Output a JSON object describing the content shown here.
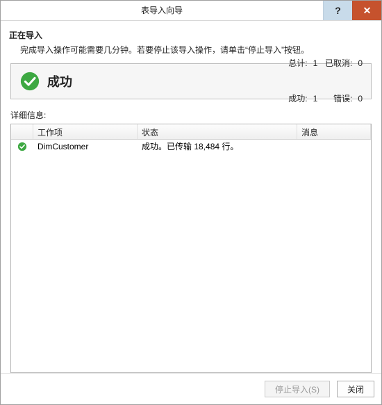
{
  "window": {
    "title": "表导入向导"
  },
  "header": {
    "heading": "正在导入",
    "instruction": "完成导入操作可能需要几分钟。若要停止该导入操作，请单击“停止导入”按钮。"
  },
  "status": {
    "title": "成功",
    "total_label": "总计:",
    "total_value": "1",
    "cancelled_label": "已取消:",
    "cancelled_value": "0",
    "success_label": "成功:",
    "success_value": "1",
    "error_label": "错误:",
    "error_value": "0"
  },
  "details": {
    "label": "详细信息:",
    "columns": {
      "work_item": "工作项",
      "status": "状态",
      "message": "消息"
    },
    "rows": [
      {
        "icon": "success-check",
        "work_item": "DimCustomer",
        "status": "成功。已传输 18,484 行。",
        "message": ""
      }
    ]
  },
  "footer": {
    "stop_import_label": "停止导入(S)",
    "close_label": "关闭"
  },
  "colors": {
    "success": "#3da842"
  }
}
